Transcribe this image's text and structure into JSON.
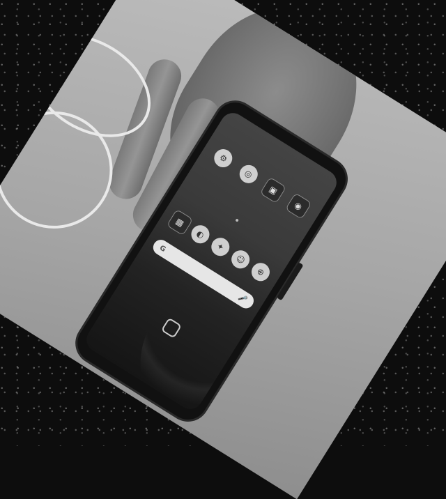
{
  "home_screen": {
    "top_row": [
      {
        "label": "",
        "glyph": "⚙"
      },
      {
        "label": "",
        "glyph": "◎"
      },
      {
        "label": "",
        "glyph": "▣"
      },
      {
        "label": "",
        "glyph": "◉"
      }
    ],
    "dock_row": [
      {
        "label": "",
        "glyph": "▦"
      },
      {
        "label": "",
        "glyph": "◐"
      },
      {
        "label": "",
        "glyph": "✦"
      },
      {
        "label": "",
        "glyph": "☺"
      },
      {
        "label": "",
        "glyph": "⊕"
      }
    ],
    "search_bar": {
      "g_glyph": "G",
      "mic_glyph": "🎤"
    },
    "center_icon_name": "rounded-square-icon"
  },
  "colors": {
    "background": "#0d0d0d",
    "photo": "#a6a6a6",
    "phone_body": "#111111",
    "icon_fill": "#cfcfcf"
  }
}
